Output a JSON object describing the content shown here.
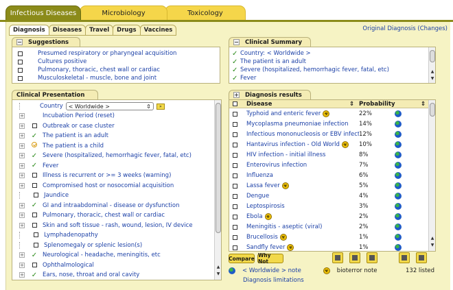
{
  "top_tabs": [
    {
      "label": "Infectious Diseases"
    },
    {
      "label": "Microbiology"
    },
    {
      "label": "Toxicology"
    }
  ],
  "sub_tabs": [
    {
      "label": "Diagnosis"
    },
    {
      "label": "Diseases"
    },
    {
      "label": "Travel"
    },
    {
      "label": "Drugs"
    },
    {
      "label": "Vaccines"
    }
  ],
  "original_diagnosis_link": "Original Diagnosis (Changes)",
  "suggestions": {
    "title": "Suggestions",
    "items": [
      "Presumed respiratory or pharyngeal acquisition",
      "Cultures positive",
      "Pulmonary, thoracic, chest wall or cardiac",
      "Musculoskeletal - muscle, bone and joint"
    ]
  },
  "clinical_summary": {
    "title": "Clinical Summary",
    "items": [
      "Country: < Worldwide >",
      "The patient is an adult",
      "Severe (hospitalized, hemorrhagic fever, fatal, etc)",
      "Fever"
    ]
  },
  "clinical_presentation": {
    "title": "Clinical Presentation",
    "country_label": "Country",
    "country_value": "< Worldwide >",
    "items": [
      {
        "label": "Incubation Period (reset)",
        "state": "none",
        "expand": true
      },
      {
        "label": "Outbreak or case cluster",
        "state": "unchecked",
        "expand": true
      },
      {
        "label": "The patient is an adult",
        "state": "checked",
        "expand": true
      },
      {
        "label": "The patient is a child",
        "state": "warn",
        "expand": true
      },
      {
        "label": "Severe (hospitalized, hemorrhagic fever, fatal, etc)",
        "state": "checked",
        "expand": true
      },
      {
        "label": "Fever",
        "state": "checked",
        "expand": true
      },
      {
        "label": "Illness is recurrent or >= 3 weeks (warning)",
        "state": "unchecked",
        "expand": true
      },
      {
        "label": "Compromised host or nosocomial acquisition",
        "state": "unchecked",
        "expand": true
      },
      {
        "label": "Jaundice",
        "state": "unchecked",
        "expand": false
      },
      {
        "label": "GI and intraabdominal - disease or dysfunction",
        "state": "checked",
        "expand": true
      },
      {
        "label": "Pulmonary, thoracic, chest wall or cardiac",
        "state": "unchecked",
        "expand": true
      },
      {
        "label": "Skin and soft tissue - rash, wound, lesion, IV device",
        "state": "unchecked",
        "expand": true
      },
      {
        "label": "Lymphadenopathy",
        "state": "unchecked",
        "expand": false
      },
      {
        "label": "Splenomegaly or splenic lesion(s)",
        "state": "unchecked",
        "expand": false
      },
      {
        "label": "Neurological - headache, meningitis, etc",
        "state": "checked",
        "expand": true
      },
      {
        "label": "Ophthalmological",
        "state": "unchecked",
        "expand": true
      },
      {
        "label": "Ears, nose, throat and oral cavity",
        "state": "checked",
        "expand": true
      }
    ]
  },
  "diagnosis_results": {
    "title": "Diagnosis results",
    "col_disease": "Disease",
    "col_probability": "Probability",
    "rows": [
      {
        "disease": "Typhoid and enteric fever",
        "bio": true,
        "prob": "22%"
      },
      {
        "disease": "Mycoplasma pneumoniae infection",
        "bio": false,
        "prob": "14%"
      },
      {
        "disease": "Infectious mononucleosis or EBV infection",
        "bio": false,
        "prob": "12%"
      },
      {
        "disease": "Hantavirus infection - Old World",
        "bio": true,
        "prob": "10%"
      },
      {
        "disease": "HIV infection - initial illness",
        "bio": false,
        "prob": "8%"
      },
      {
        "disease": "Enterovirus infection",
        "bio": false,
        "prob": "7%"
      },
      {
        "disease": "Influenza",
        "bio": false,
        "prob": "6%"
      },
      {
        "disease": "Lassa fever",
        "bio": true,
        "prob": "5%"
      },
      {
        "disease": "Dengue",
        "bio": false,
        "prob": "4%"
      },
      {
        "disease": "Leptospirosis",
        "bio": false,
        "prob": "3%"
      },
      {
        "disease": "Ebola",
        "bio": true,
        "prob": "2%"
      },
      {
        "disease": "Meningitis - aseptic (viral)",
        "bio": false,
        "prob": "2%"
      },
      {
        "disease": "Brucellosis",
        "bio": true,
        "prob": "1%"
      },
      {
        "disease": "Sandfly fever",
        "bio": true,
        "prob": "1%"
      }
    ],
    "compare_label": "Compare",
    "whynot_label": "Why Not"
  },
  "legend": {
    "worldwide_note": "< Worldwide > note",
    "bioterror_note": "bioterror note",
    "listed": "132 listed",
    "limitations": "Diagnosis limitations"
  },
  "colors": {
    "accent": "#8b8b1a",
    "tab_yellow": "#f5d64a",
    "panel_bg": "#f6f3c4",
    "link": "#1a3fa6"
  }
}
